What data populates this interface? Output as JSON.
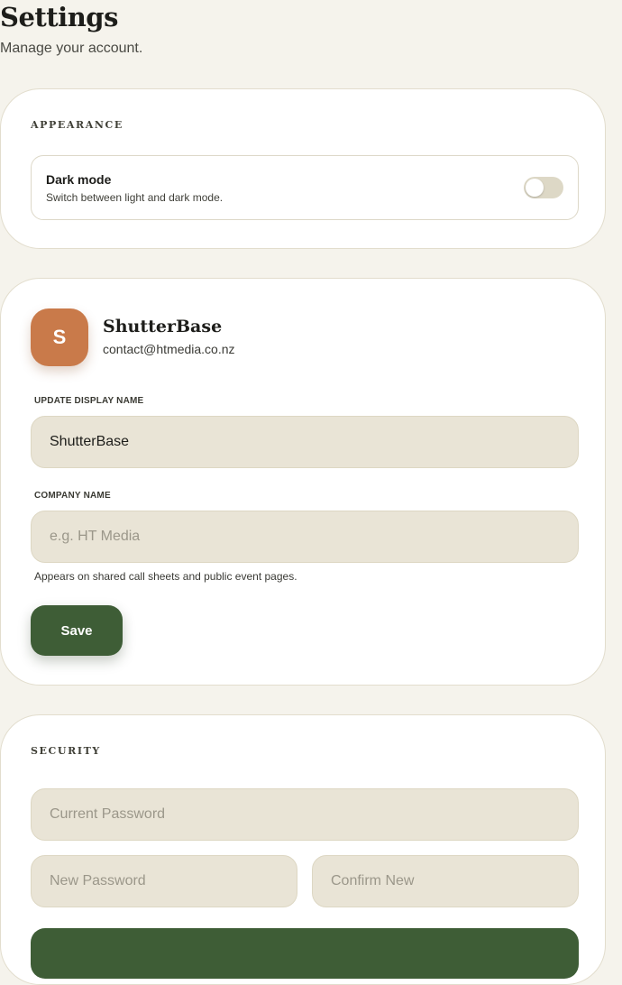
{
  "header": {
    "title": "Settings",
    "subtitle": "Manage your account."
  },
  "appearance": {
    "heading": "APPEARANCE",
    "dark_mode": {
      "title": "Dark mode",
      "description": "Switch between light and dark mode.",
      "enabled": false
    }
  },
  "profile": {
    "avatar_initial": "S",
    "name": "ShutterBase",
    "email": "contact@htmedia.co.nz",
    "display_name_label": "UPDATE DISPLAY NAME",
    "display_name_value": "ShutterBase",
    "company_label": "COMPANY NAME",
    "company_value": "",
    "company_placeholder": "e.g. HT Media",
    "company_helper": "Appears on shared call sheets and public event pages.",
    "save_label": "Save"
  },
  "security": {
    "heading": "SECURITY",
    "current_password_placeholder": "Current Password",
    "new_password_placeholder": "New Password",
    "confirm_password_placeholder": "Confirm New"
  },
  "colors": {
    "background": "#f5f3ec",
    "card": "#ffffff",
    "input": "#e9e4d6",
    "primary": "#3e5d36",
    "avatar": "#c97a4a"
  }
}
